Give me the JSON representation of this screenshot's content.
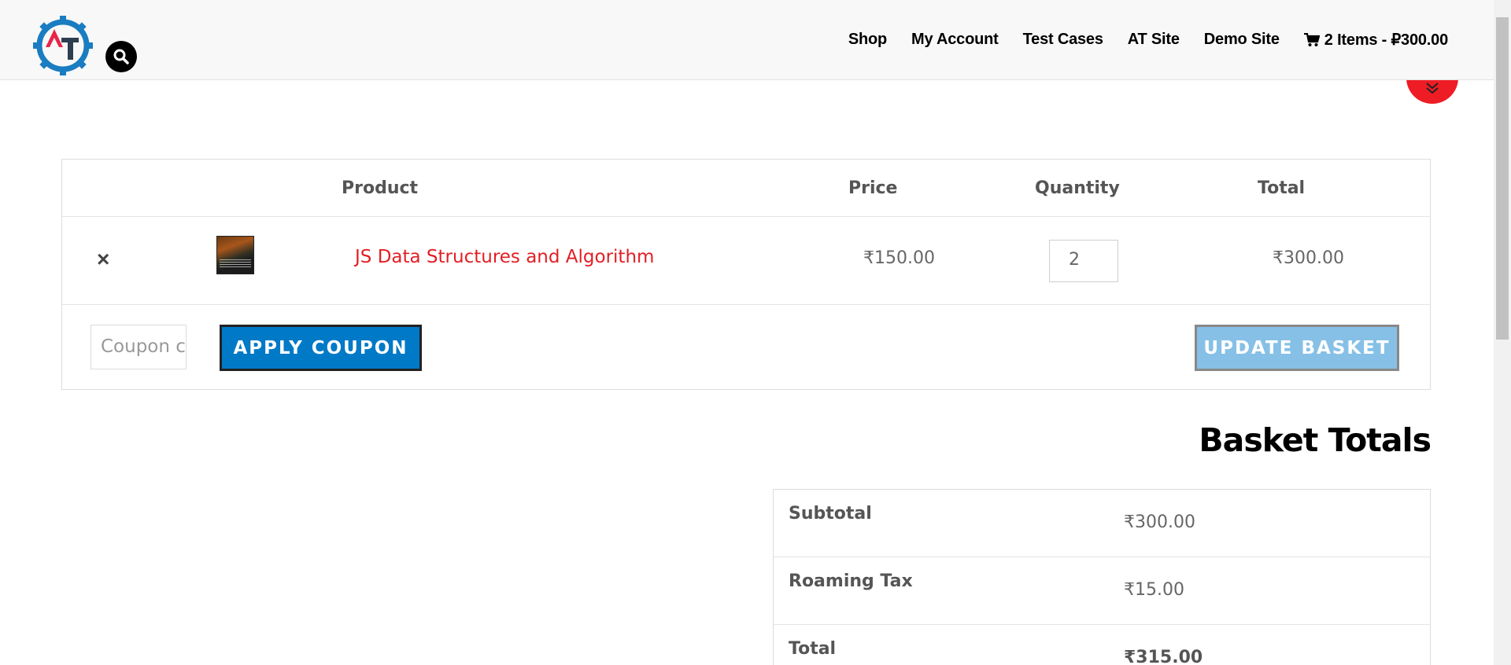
{
  "header": {
    "nav": {
      "shop": "Shop",
      "my_account": "My Account",
      "test_cases": "Test Cases",
      "at_site": "AT Site",
      "demo_site": "Demo Site",
      "cart": "2 Items - ₽300.00"
    },
    "icons": {
      "logo": "automation-testing-gear-logo",
      "search": "search-icon",
      "cart": "cart-icon",
      "scroll": "double-chevron-down-icon"
    }
  },
  "cart": {
    "headers": {
      "product": "Product",
      "price": "Price",
      "quantity": "Quantity",
      "total": "Total"
    },
    "items": [
      {
        "remove": "×",
        "name": "JS Data Structures and Algorithm",
        "price": "₹150.00",
        "quantity": "2",
        "total": "₹300.00"
      }
    ],
    "coupon_placeholder": "Coupon code",
    "apply_coupon": "APPLY COUPON",
    "update_basket": "UPDATE BASKET"
  },
  "totals": {
    "title": "Basket Totals",
    "rows": [
      {
        "label": "Subtotal",
        "value": "₹300.00"
      },
      {
        "label": "Roaming Tax",
        "value": "₹15.00"
      },
      {
        "label": "Total",
        "value": "₹315.00"
      }
    ]
  },
  "colors": {
    "accent_red": "#ee1c25",
    "link_red": "#e31e24",
    "button_blue": "#0079c7",
    "button_blue_disabled": "#86c0e6"
  }
}
